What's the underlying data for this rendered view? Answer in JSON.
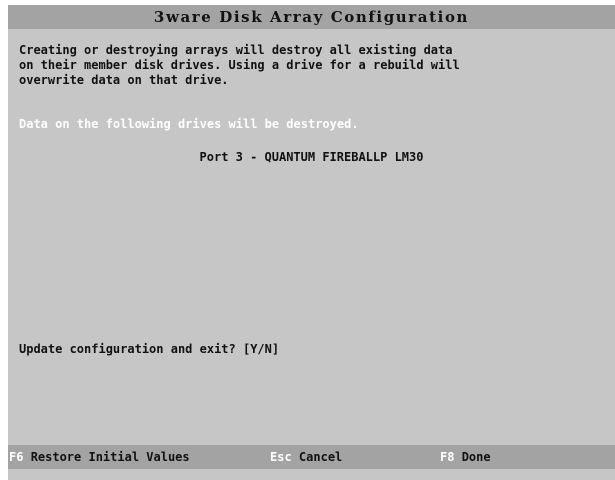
{
  "header": {
    "title": "3ware Disk Array Configuration"
  },
  "warning": {
    "lines": [
      "Creating or destroying arrays will destroy all existing data",
      "on their member disk drives. Using a drive for a rebuild will",
      "overwrite data on that drive."
    ]
  },
  "destroy_note": "Data on the following drives will be destroyed.",
  "drives": [
    "Port 3 - QUANTUM FIREBALLP LM30"
  ],
  "prompt": "Update configuration and exit? [Y/N]",
  "footer": {
    "f6_key": "F6",
    "f6_label": "Restore Initial Values",
    "esc_key": "Esc",
    "esc_label": "Cancel",
    "f8_key": "F8",
    "f8_label": "Done"
  },
  "colors": {
    "screen_background": "#c6c6c6",
    "bar_background": "#a3a3a3",
    "text": "#111111",
    "highlight_text": "#ffffff"
  }
}
